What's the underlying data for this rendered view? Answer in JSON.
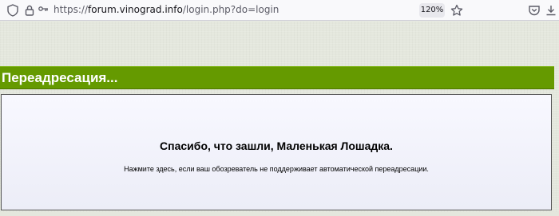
{
  "browser": {
    "url_prefix": "https://",
    "url_host": "forum.vinograd.info",
    "url_path": "/login.php?do=login",
    "zoom": "120%",
    "icons": {
      "shield": "tracking-protection-icon",
      "lock": "lock-icon",
      "permissions": "permissions-icon",
      "bookmark": "bookmark-star-icon",
      "pocket": "pocket-icon",
      "download": "download-icon"
    }
  },
  "redirect": {
    "title": "Переадресация...",
    "message": "Спасибо, что зашли, Маленькая Лошадка.",
    "link_text": "Нажмите здесь, если ваш обозреватель не поддерживает автоматической переадресации."
  },
  "colors": {
    "header_green": "#659a00",
    "page_bg": "#e4e7dd",
    "panel_bg": "#f8f8ff"
  }
}
